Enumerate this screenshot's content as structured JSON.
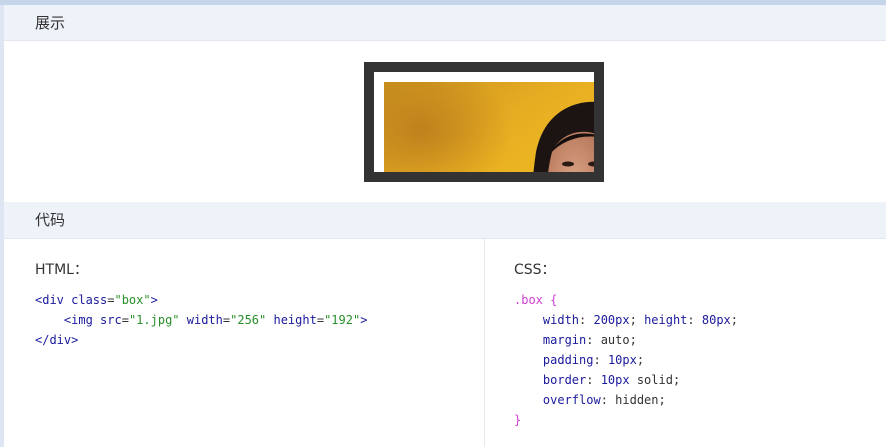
{
  "sections": {
    "demo": {
      "title": "展示"
    },
    "code": {
      "title": "代码"
    }
  },
  "demo_image": {
    "name": "photo-of-woman-on-yellow-background"
  },
  "html_panel": {
    "label": "HTML：",
    "lines": [
      [
        {
          "t": "<div ",
          "k": "tag"
        },
        {
          "t": "class",
          "k": "attr"
        },
        {
          "t": "=",
          "k": "plain"
        },
        {
          "t": "\"box\"",
          "k": "str"
        },
        {
          "t": ">",
          "k": "tag"
        }
      ],
      [
        {
          "t": "    <img ",
          "k": "tag"
        },
        {
          "t": "src",
          "k": "attr"
        },
        {
          "t": "=",
          "k": "plain"
        },
        {
          "t": "\"1.jpg\"",
          "k": "str"
        },
        {
          "t": " width",
          "k": "attr"
        },
        {
          "t": "=",
          "k": "plain"
        },
        {
          "t": "\"256\"",
          "k": "str"
        },
        {
          "t": " height",
          "k": "attr"
        },
        {
          "t": "=",
          "k": "plain"
        },
        {
          "t": "\"192\"",
          "k": "str"
        },
        {
          "t": ">",
          "k": "tag"
        }
      ],
      [
        {
          "t": "</div>",
          "k": "tag"
        }
      ]
    ]
  },
  "css_panel": {
    "label": "CSS：",
    "lines": [
      [
        {
          "t": ".box {",
          "k": "sel"
        }
      ],
      [
        {
          "t": "    width",
          "k": "prop"
        },
        {
          "t": ": ",
          "k": "plain"
        },
        {
          "t": "200px",
          "k": "num"
        },
        {
          "t": "; ",
          "k": "plain"
        },
        {
          "t": "height",
          "k": "prop"
        },
        {
          "t": ": ",
          "k": "plain"
        },
        {
          "t": "80px",
          "k": "num"
        },
        {
          "t": ";",
          "k": "plain"
        }
      ],
      [
        {
          "t": "    margin",
          "k": "prop"
        },
        {
          "t": ": auto;",
          "k": "plain"
        }
      ],
      [
        {
          "t": "    padding",
          "k": "prop"
        },
        {
          "t": ": ",
          "k": "plain"
        },
        {
          "t": "10px",
          "k": "num"
        },
        {
          "t": ";",
          "k": "plain"
        }
      ],
      [
        {
          "t": "    border",
          "k": "prop"
        },
        {
          "t": ": ",
          "k": "plain"
        },
        {
          "t": "10px",
          "k": "num"
        },
        {
          "t": " solid;",
          "k": "plain"
        }
      ],
      [
        {
          "t": "    overflow",
          "k": "prop"
        },
        {
          "t": ": hidden;",
          "k": "plain"
        }
      ],
      [
        {
          "t": "}",
          "k": "sel"
        }
      ]
    ]
  }
}
